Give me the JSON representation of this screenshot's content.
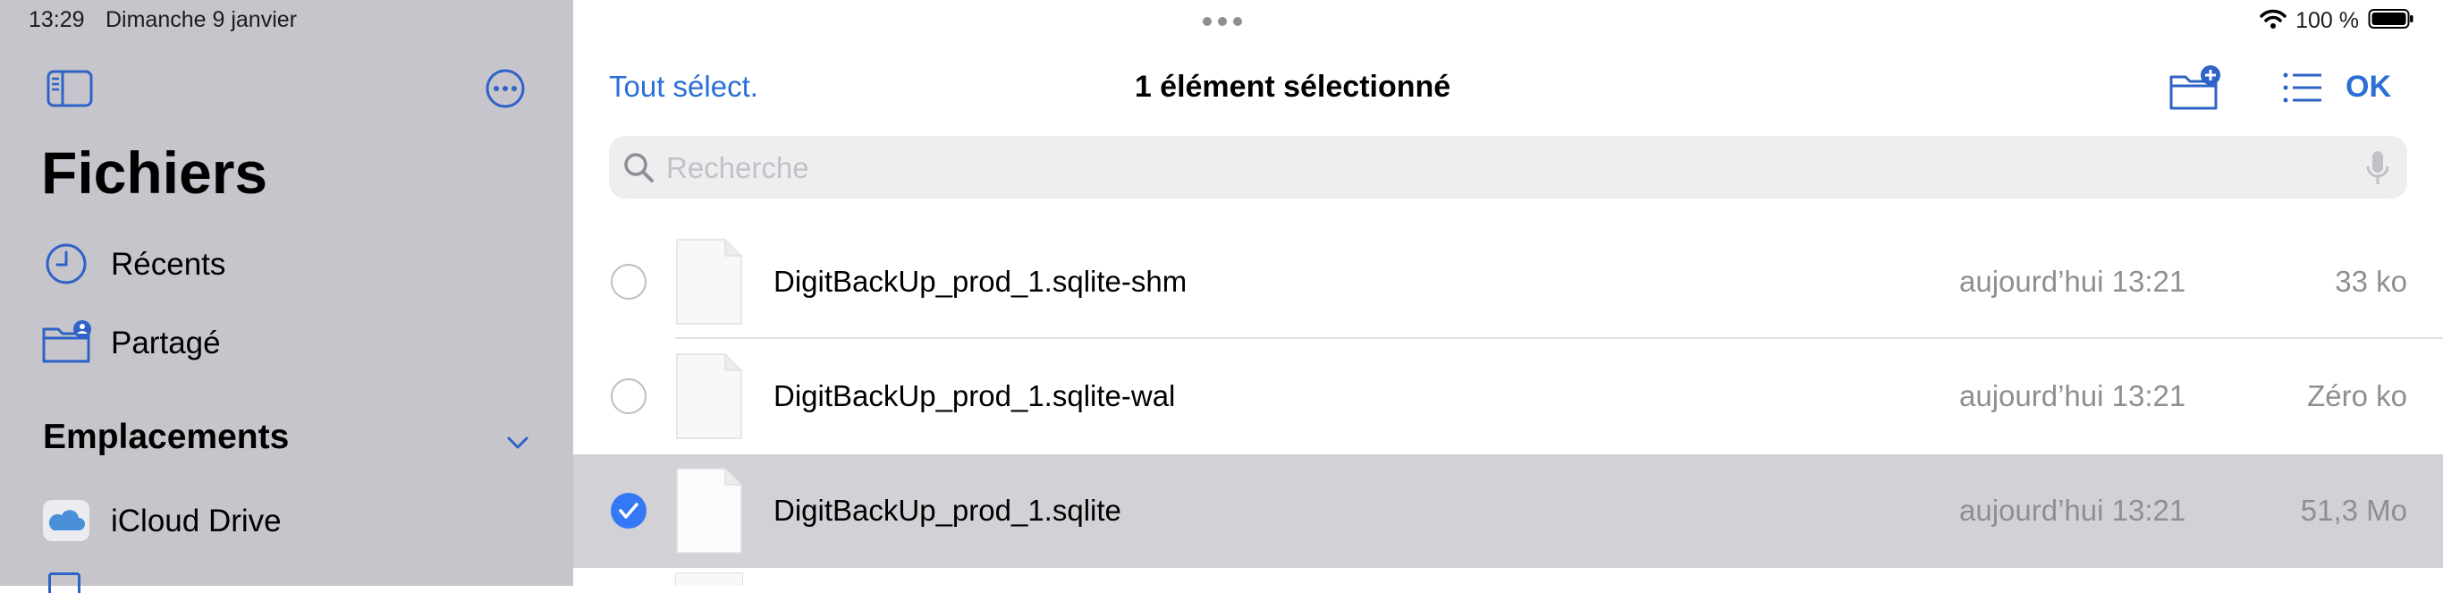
{
  "status_bar": {
    "time": "13:29",
    "date": "Dimanche 9 janvier",
    "battery": "100 %",
    "icons": [
      "wifi-icon",
      "battery-icon"
    ]
  },
  "sidebar": {
    "title": "Fichiers",
    "items": [
      {
        "label": "Récents",
        "icon": "clock-icon"
      },
      {
        "label": "Partagé",
        "icon": "shared-folder-icon"
      }
    ],
    "section_title": "Emplacements",
    "locations": [
      {
        "label": "iCloud Drive",
        "icon": "icloud-icon"
      }
    ]
  },
  "toolbar": {
    "select_all": "Tout sélect.",
    "title": "1 élément sélectionné",
    "ok": "OK",
    "icons": [
      "new-folder-icon",
      "list-view-icon"
    ]
  },
  "search": {
    "placeholder": "Recherche",
    "value": ""
  },
  "files": [
    {
      "name": "DigitBackUp_prod_1.sqlite-shm",
      "date": "aujourd’hui 13:21",
      "size": "33 ko",
      "selected": false
    },
    {
      "name": "DigitBackUp_prod_1.sqlite-wal",
      "date": "aujourd’hui 13:21",
      "size": "Zéro ko",
      "selected": false
    },
    {
      "name": "DigitBackUp_prod_1.sqlite",
      "date": "aujourd’hui 13:21",
      "size": "51,3 Mo",
      "selected": true
    }
  ],
  "colors": {
    "accent": "#2a6fd6",
    "checkbox": "#3478f6",
    "sidebar_bg": "#c6c5cb",
    "selected_row": "#d1d1d6"
  }
}
